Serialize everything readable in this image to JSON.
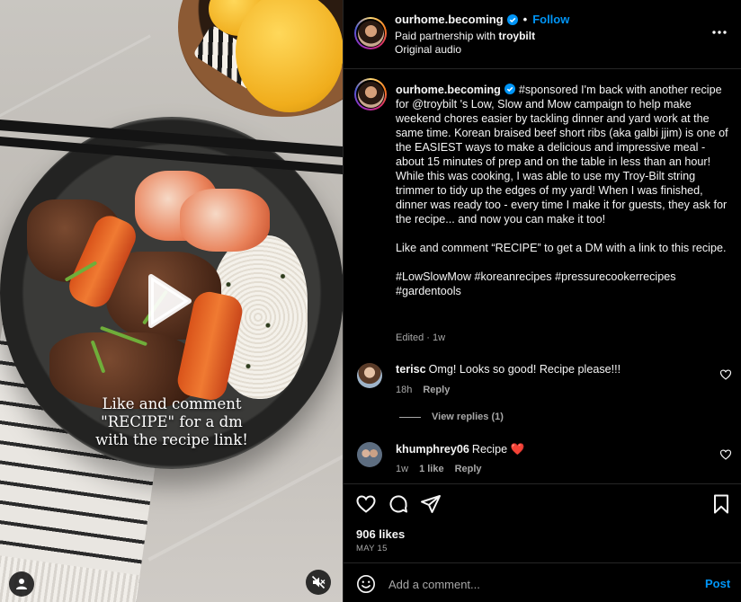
{
  "media": {
    "overlay_text": "Like and comment \"RECIPE\" for a dm with the recipe link!",
    "play_icon": "play-icon",
    "user_tag_icon": "person-icon",
    "mute_icon": "speaker-muted-icon"
  },
  "header": {
    "username": "ourhome.becoming",
    "follow_label": "Follow",
    "separator": "•",
    "partnership_prefix": "Paid partnership with ",
    "partner": "troybilt",
    "audio": "Original audio",
    "more_icon": "more-horizontal-icon"
  },
  "caption": {
    "username": "ourhome.becoming",
    "paragraph1": "#sponsored I'm back with another recipe for @troybilt 's Low, Slow and Mow campaign to help make weekend chores easier by tackling dinner and yard work at the same time. Korean braised beef short ribs (aka galbi jjim) is one of the EASIEST ways to make a delicious and impressive meal - about 15 minutes of prep and on the table in less than an hour! While this was cooking, I was able to use my Troy-Bilt string trimmer to tidy up the edges of my yard! When I was finished, dinner was ready too - every time I make it for guests, they ask for the recipe... and now you can make it too!",
    "paragraph2": "Like and comment “RECIPE” to get a DM with a link to this recipe.",
    "paragraph3": "#LowSlowMow #koreanrecipes #pressurecookerrecipes #gardentools",
    "edited": "Edited · 1w"
  },
  "comments": [
    {
      "username": "terisc",
      "text": "Omg! Looks so good! Recipe please!!!",
      "time": "18h",
      "reply_label": "Reply"
    },
    {
      "username": "khumphrey06",
      "text": "Recipe ",
      "emoji": "❤️",
      "time": "1w",
      "likes": "1 like",
      "reply_label": "Reply"
    }
  ],
  "view_replies": "View replies (1)",
  "actions": {
    "like_icon": "heart-icon",
    "comment_icon": "comment-icon",
    "share_icon": "share-icon",
    "save_icon": "bookmark-icon"
  },
  "likes": "906 likes",
  "date": "MAY 15",
  "add_comment": {
    "placeholder": "Add a comment...",
    "post_label": "Post",
    "emoji_icon": "emoji-icon"
  },
  "colors": {
    "accent_blue": "#0095f6",
    "background": "#000000",
    "secondary_text": "#a8a8a8",
    "heart_red": "#ff3040"
  }
}
